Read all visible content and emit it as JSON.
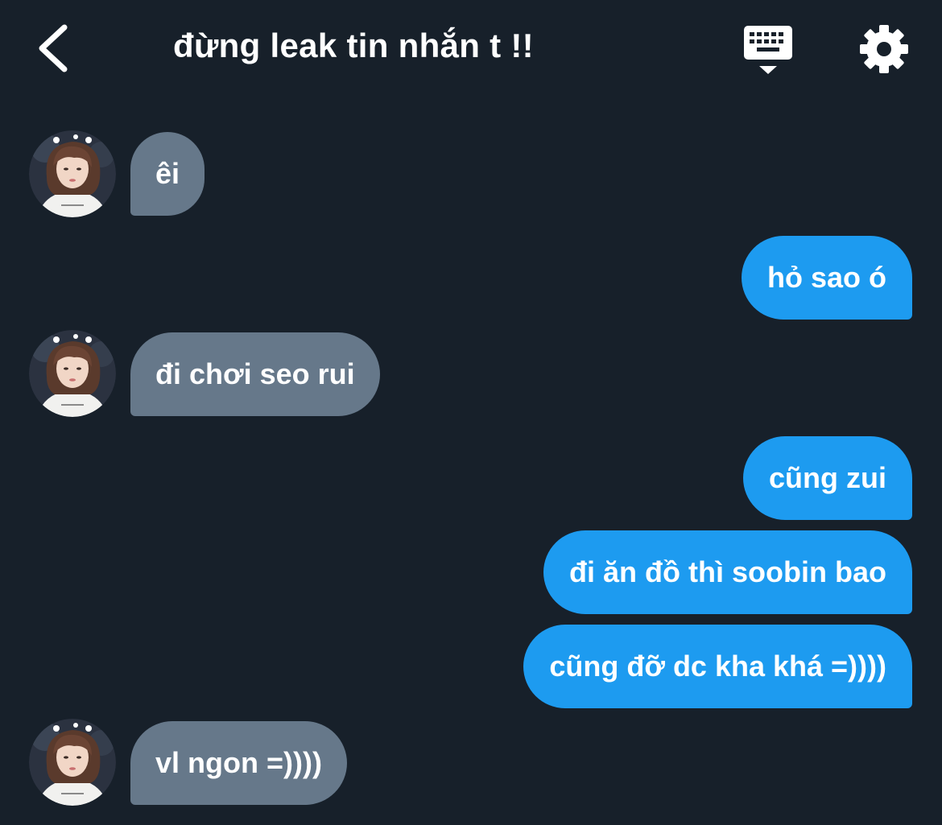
{
  "header": {
    "title": "đừng leak tin nhắn t !!",
    "back_icon": "chevron-left-icon",
    "keyboard_icon": "keyboard-icon",
    "settings_icon": "gear-icon"
  },
  "colors": {
    "background": "#17202a",
    "incoming_bubble": "#66788a",
    "outgoing_bubble": "#1d9bf0",
    "text": "#ffffff"
  },
  "messages": [
    {
      "sender": "them",
      "text": "êi"
    },
    {
      "sender": "me",
      "text": "hỏ sao ó"
    },
    {
      "sender": "them",
      "text": "đi chơi seo rui"
    },
    {
      "sender": "me",
      "text": "cũng zui"
    },
    {
      "sender": "me",
      "text": "đi ăn đồ thì soobin bao"
    },
    {
      "sender": "me",
      "text": "cũng đỡ dc kha khá =))))"
    },
    {
      "sender": "them",
      "text": "vl ngon =))))"
    }
  ]
}
